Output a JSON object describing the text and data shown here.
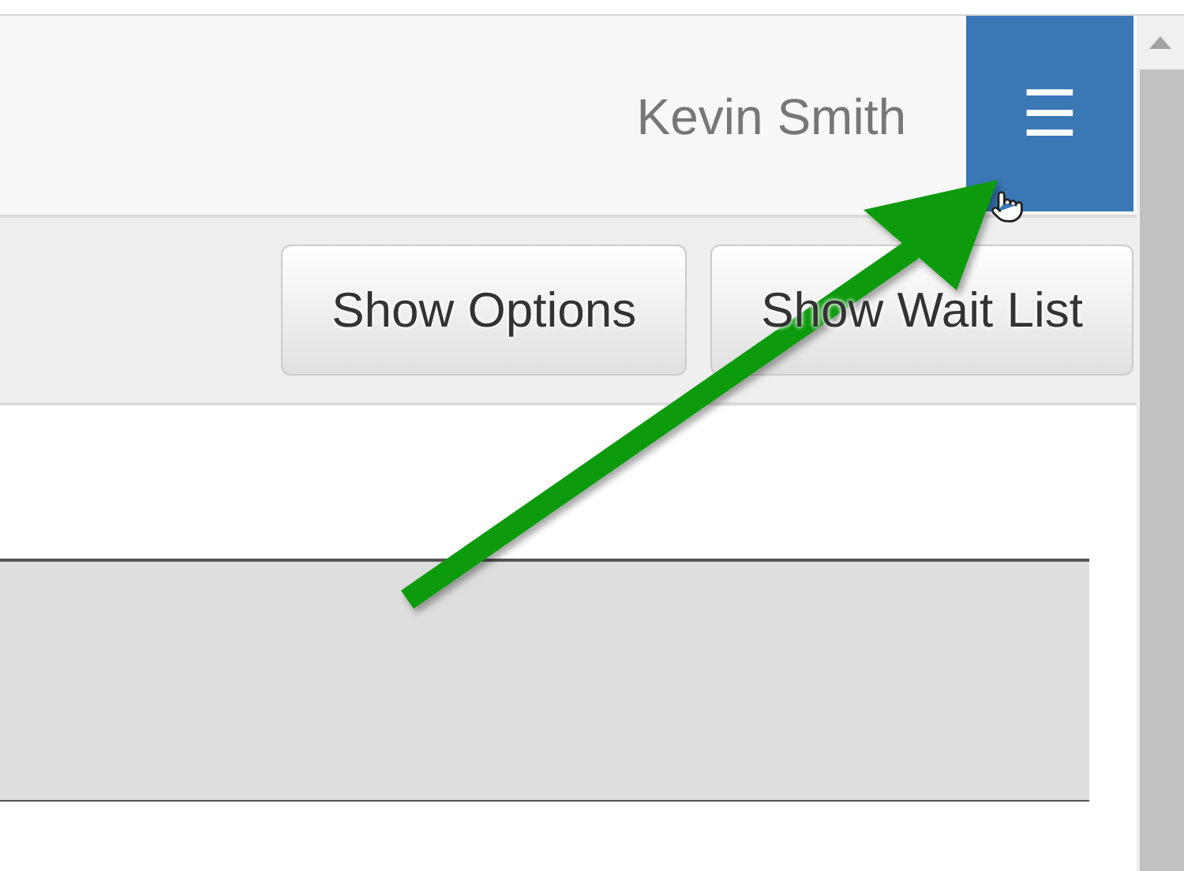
{
  "header": {
    "user_name": "Kevin Smith",
    "menu_button": {
      "icon": "☰"
    }
  },
  "toolbar": {
    "buttons": [
      {
        "label": "Show Options"
      },
      {
        "label": "Show Wait List"
      }
    ]
  }
}
